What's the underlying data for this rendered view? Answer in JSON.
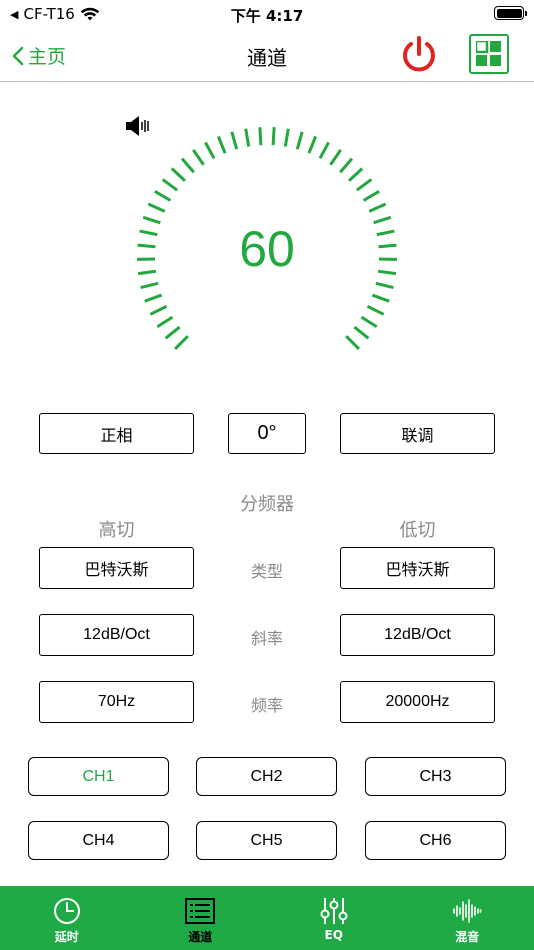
{
  "status": {
    "carrier": "CF-T16",
    "time": "下午 4:17"
  },
  "nav": {
    "back_label": "主页",
    "title": "通道"
  },
  "gauge": {
    "value": "60",
    "level_percent": 100
  },
  "phase": {
    "polarity_label": "正相",
    "angle_label": "0°",
    "link_label": "联调"
  },
  "crossover": {
    "title": "分频器",
    "high_cut_title": "高切",
    "low_cut_title": "低切",
    "rows": [
      {
        "label": "类型",
        "high_value": "巴特沃斯",
        "low_value": "巴特沃斯"
      },
      {
        "label": "斜率",
        "high_value": "12dB/Oct",
        "low_value": "12dB/Oct"
      },
      {
        "label": "频率",
        "high_value": "70Hz",
        "low_value": "20000Hz"
      }
    ]
  },
  "channels": [
    {
      "label": "CH1",
      "active": true
    },
    {
      "label": "CH2",
      "active": false
    },
    {
      "label": "CH3",
      "active": false
    },
    {
      "label": "CH4",
      "active": false
    },
    {
      "label": "CH5",
      "active": false
    },
    {
      "label": "CH6",
      "active": false
    }
  ],
  "tabs": [
    {
      "label": "延时",
      "icon": "clock-icon"
    },
    {
      "label": "通道",
      "icon": "list-icon"
    },
    {
      "label": "EQ",
      "icon": "sliders-icon"
    },
    {
      "label": "混音",
      "icon": "waveform-icon"
    }
  ],
  "colors": {
    "accent": "#22a83f",
    "tab_bar": "#1faa45",
    "power": "#e02424"
  }
}
